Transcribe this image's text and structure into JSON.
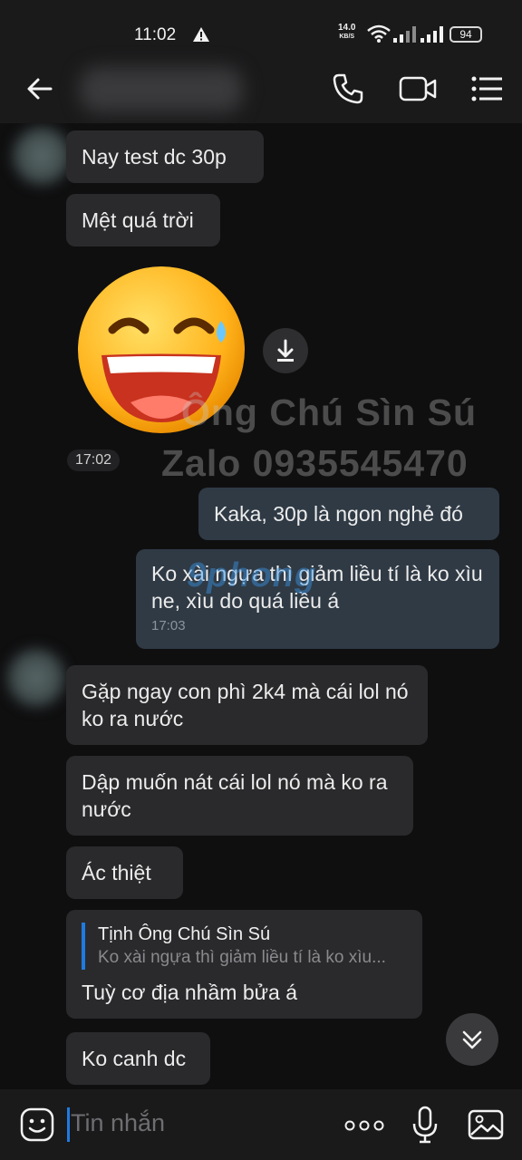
{
  "status_bar": {
    "time": "11:02",
    "net_speed": "14.0",
    "net_unit": "KB/S",
    "battery": "94"
  },
  "header": {
    "back_icon": "arrow-left-icon",
    "call_icon": "phone-icon",
    "video_icon": "video-camera-icon",
    "menu_icon": "list-menu-icon"
  },
  "messages": {
    "m1": "Nay test dc 30p",
    "m2": "Mệt quá trời",
    "sticker_time": "17:02",
    "m3": "Kaka, 30p là ngon nghẻ đó",
    "m4": "Ko xài ngựa thì giảm liều tí là ko xìu ne, xìu do quá liều á",
    "m4_time": "17:03",
    "m5": "Gặp ngay con phì 2k4 mà cái lol nó ko ra nước",
    "m6": "Dập muốn nát cái lol nó mà ko ra nước",
    "m7": "Ác thiệt",
    "m8_quote_name": "Tịnh Ông Chú Sìn Sú",
    "m8_quote_text": "Ko xài ngựa thì giảm liều tí là ko xìu...",
    "m8": "Tuỳ cơ địa nhầm bửa á",
    "m9": "Ko canh dc"
  },
  "watermark": {
    "line1": "Ông Chú Sìn Sú",
    "line2": "Zalo 0935545470",
    "brand": "9phong"
  },
  "input": {
    "placeholder": "Tin nhắn"
  },
  "colors": {
    "accent": "#1f7be0",
    "incoming_bubble": "#2a2a2c",
    "outgoing_bubble": "#2f3a45",
    "background": "#0f0f10"
  }
}
